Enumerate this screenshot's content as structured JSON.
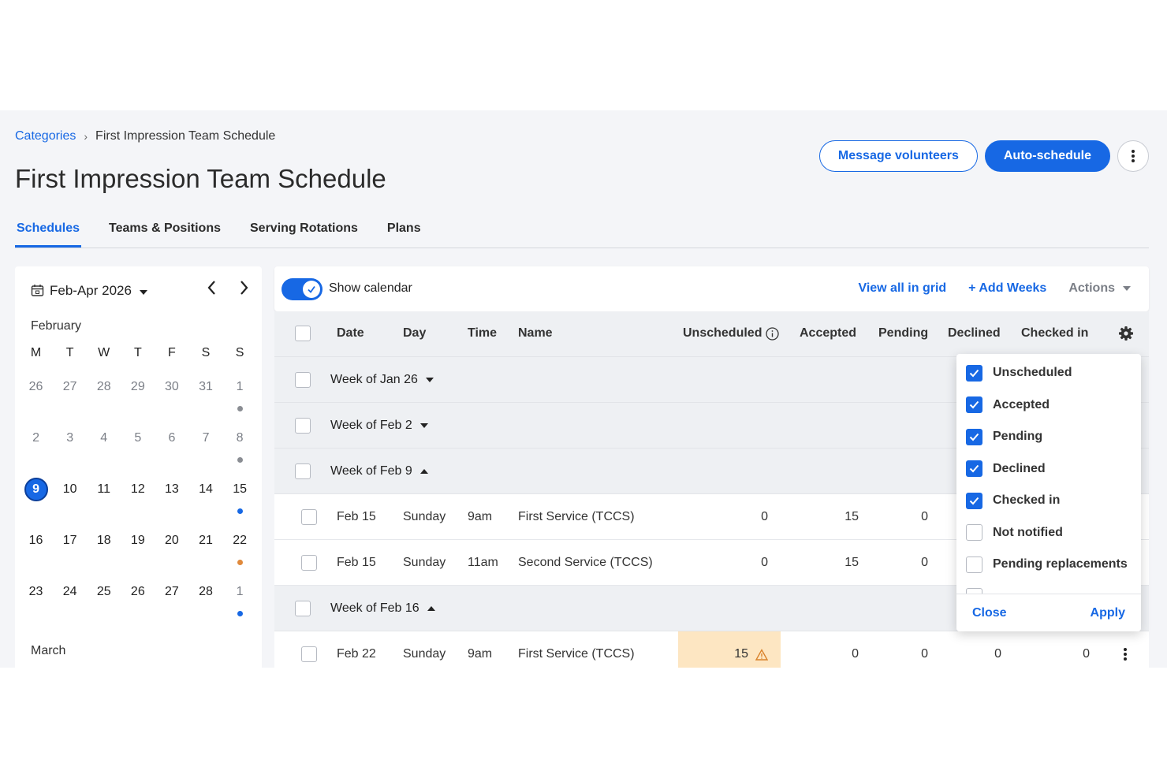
{
  "breadcrumb": {
    "link": "Categories",
    "current": "First Impression Team Schedule"
  },
  "page": {
    "title": "First Impression Team Schedule"
  },
  "header": {
    "message_label": "Message volunteers",
    "autoschedule_label": "Auto-schedule"
  },
  "tabs": [
    {
      "label": "Schedules",
      "active": true
    },
    {
      "label": "Teams & Positions"
    },
    {
      "label": "Serving Rotations"
    },
    {
      "label": "Plans"
    }
  ],
  "calendar": {
    "range": "Feb-Apr 2026",
    "months": [
      "February",
      "March"
    ],
    "dow": [
      "M",
      "T",
      "W",
      "T",
      "F",
      "S",
      "S"
    ],
    "weeks": [
      [
        "26",
        "27",
        "28",
        "29",
        "30",
        "31",
        "1"
      ],
      [
        "2",
        "3",
        "4",
        "5",
        "6",
        "7",
        "8"
      ],
      [
        "9",
        "10",
        "11",
        "12",
        "13",
        "14",
        "15"
      ],
      [
        "16",
        "17",
        "18",
        "19",
        "20",
        "21",
        "22"
      ],
      [
        "23",
        "24",
        "25",
        "26",
        "27",
        "28",
        "1"
      ]
    ],
    "today": "9",
    "colors": {
      "gray": "#8a8d93",
      "blue": "#1768e4",
      "orange": "#e0893b"
    }
  },
  "toolbar": {
    "show_calendar": "Show calendar",
    "view_grid": "View all in grid",
    "add_weeks": "+ Add Weeks",
    "actions": "Actions"
  },
  "table": {
    "headers": {
      "date": "Date",
      "day": "Day",
      "time": "Time",
      "name": "Name",
      "unscheduled": "Unscheduled",
      "accepted": "Accepted",
      "pending": "Pending",
      "declined": "Declined",
      "checked_in": "Checked in"
    },
    "weeks": [
      "Week of Jan 26",
      "Week of Feb 2",
      "Week of Feb 9",
      "Week of Feb 16"
    ],
    "rows": [
      {
        "date": "Feb 15",
        "day": "Sunday",
        "time": "9am",
        "name": "First Service (TCCS)",
        "unscheduled": "0",
        "accepted": "15",
        "pending": "0"
      },
      {
        "date": "Feb 15",
        "day": "Sunday",
        "time": "11am",
        "name": "Second Service (TCCS)",
        "unscheduled": "0",
        "accepted": "15",
        "pending": "0"
      },
      {
        "date": "Feb 22",
        "day": "Sunday",
        "time": "9am",
        "name": "First Service (TCCS)",
        "unscheduled": "15",
        "accepted": "0",
        "pending": "0",
        "declined": "0",
        "checked_in": "0"
      }
    ]
  },
  "column_menu": {
    "items": [
      {
        "label": "Unscheduled",
        "checked": true
      },
      {
        "label": "Accepted",
        "checked": true
      },
      {
        "label": "Pending",
        "checked": true
      },
      {
        "label": "Declined",
        "checked": true
      },
      {
        "label": "Checked in",
        "checked": true
      },
      {
        "label": "Not notified",
        "checked": false
      },
      {
        "label": "Pending replacements",
        "checked": false
      }
    ],
    "close_label": "Close",
    "apply_label": "Apply"
  }
}
